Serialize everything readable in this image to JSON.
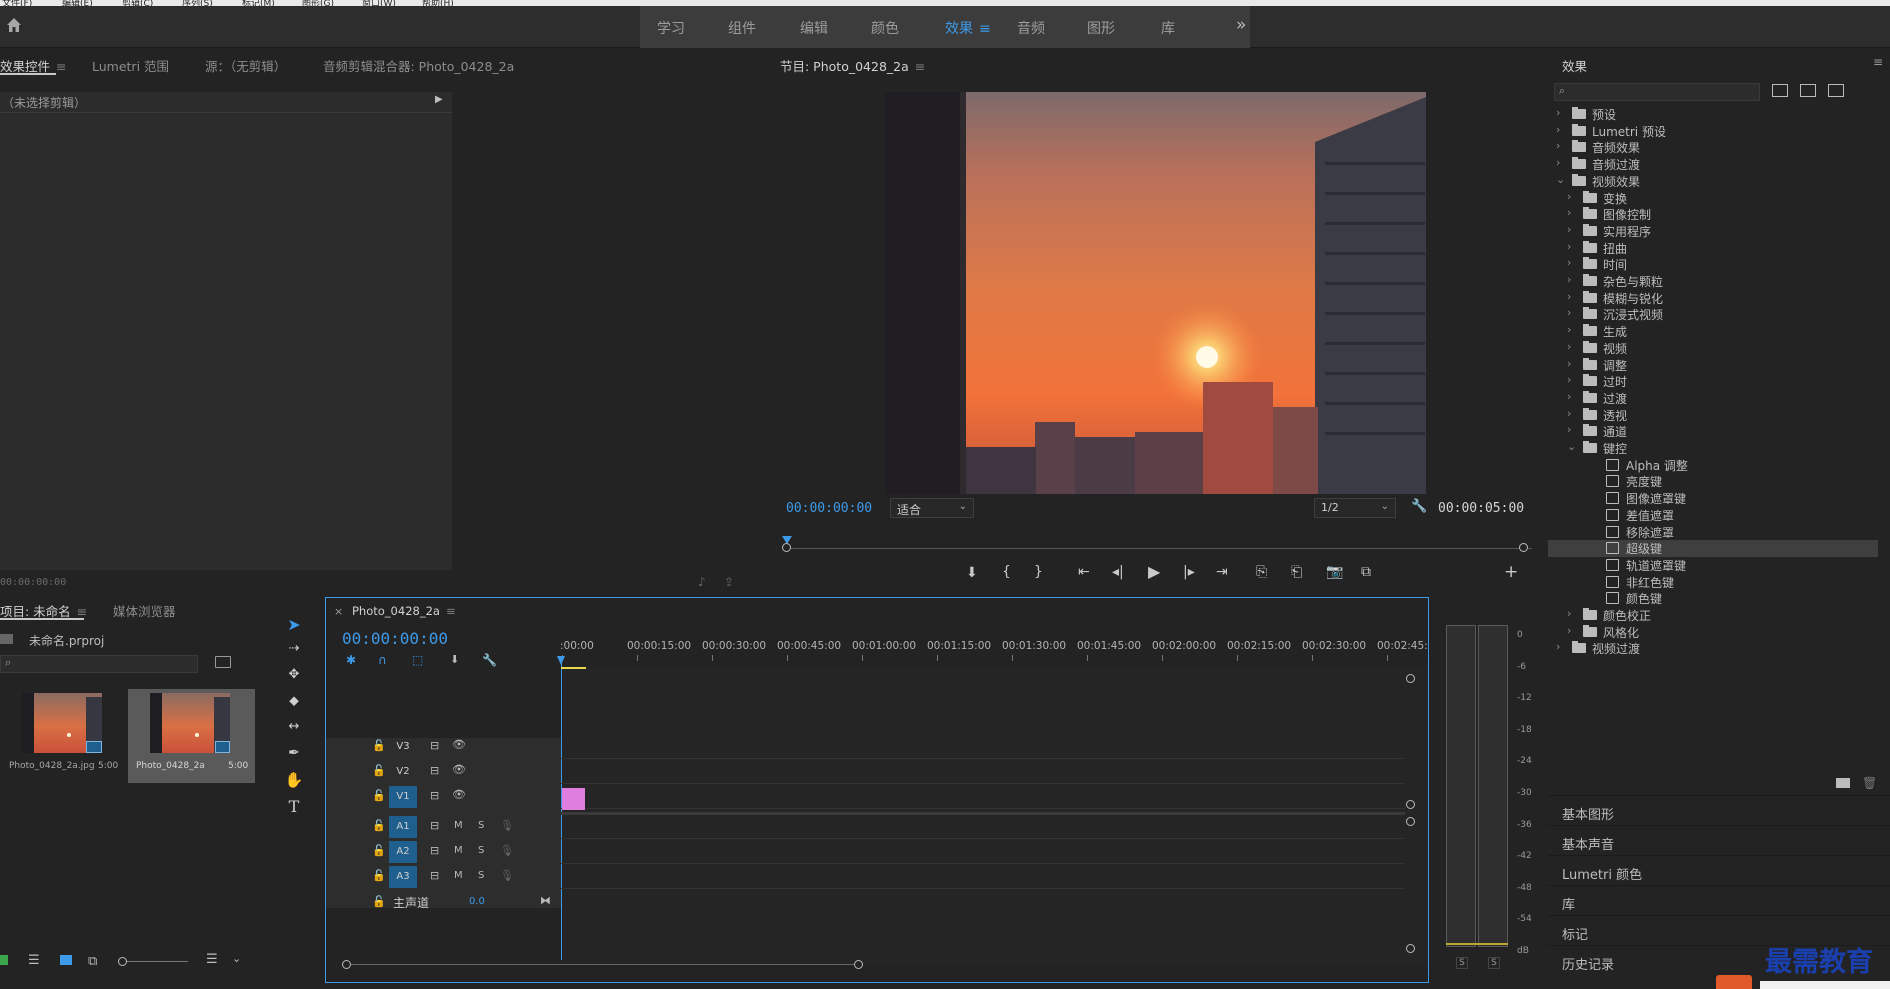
{
  "menubar": {
    "items": [
      "文件(F)",
      "编辑(E)",
      "剪辑(C)",
      "序列(S)",
      "标记(M)",
      "图形(G)",
      "窗口(W)",
      "帮助(H)"
    ]
  },
  "workspace": {
    "home_icon": "home-icon",
    "tabs": [
      {
        "label": "学习"
      },
      {
        "label": "组件"
      },
      {
        "label": "编辑"
      },
      {
        "label": "颜色"
      },
      {
        "label": "效果",
        "active": true
      },
      {
        "label": "音频"
      },
      {
        "label": "图形"
      },
      {
        "label": "库"
      }
    ],
    "overflow": "»"
  },
  "source_panel": {
    "tabs": [
      "效果控件",
      "Lumetri 范围",
      "源：（无剪辑）",
      "音频剪辑混合器: Photo_0428_2a"
    ],
    "no_clip": "（未选择剪辑）",
    "timecode": "00:00:00:00"
  },
  "program_monitor": {
    "title": "节目: Photo_0428_2a",
    "timecode_left": "00:00:00:00",
    "fit": "适合",
    "resolution": "1/2",
    "timecode_right": "00:00:05:00"
  },
  "project_panel": {
    "tabs": [
      "项目: 未命名",
      "媒体浏览器"
    ],
    "project_file": "未命名.prproj",
    "items": [
      {
        "name": "Photo_0428_2a.jpg",
        "duration": "5:00"
      },
      {
        "name": "Photo_0428_2a",
        "duration": "5:00"
      }
    ]
  },
  "timeline": {
    "sequence": "Photo_0428_2a",
    "timecode": "00:00:00:00",
    "ruler": [
      ":00:00",
      "00:00:15:00",
      "00:00:30:00",
      "00:00:45:00",
      "00:01:00:00",
      "00:01:15:00",
      "00:01:30:00",
      "00:01:45:00",
      "00:02:00:00",
      "00:02:15:00",
      "00:02:30:00",
      "00:02:45:"
    ],
    "video_tracks": [
      "V3",
      "V2",
      "V1"
    ],
    "audio_tracks": [
      "A1",
      "A2",
      "A3"
    ],
    "master_label": "主声道",
    "master_value": "0.0",
    "mute": "M",
    "solo": "S",
    "clip_color": "#e07ee0"
  },
  "audio_meter": {
    "scale": [
      "0",
      "-6",
      "-12",
      "-18",
      "-24",
      "-30",
      "-36",
      "-42",
      "-48",
      "-54",
      "dB"
    ],
    "solo_left": "S",
    "solo_right": "S"
  },
  "effects_panel": {
    "title": "效果",
    "tree": [
      {
        "label": "预设",
        "level": 0,
        "type": "folder",
        "expanded": false
      },
      {
        "label": "Lumetri 预设",
        "level": 0,
        "type": "folder",
        "expanded": false
      },
      {
        "label": "音频效果",
        "level": 0,
        "type": "folder",
        "expanded": false
      },
      {
        "label": "音频过渡",
        "level": 0,
        "type": "folder",
        "expanded": false
      },
      {
        "label": "视频效果",
        "level": 0,
        "type": "folder",
        "expanded": true
      },
      {
        "label": "变换",
        "level": 1,
        "type": "folder",
        "expanded": false
      },
      {
        "label": "图像控制",
        "level": 1,
        "type": "folder",
        "expanded": false
      },
      {
        "label": "实用程序",
        "level": 1,
        "type": "folder",
        "expanded": false
      },
      {
        "label": "扭曲",
        "level": 1,
        "type": "folder",
        "expanded": false
      },
      {
        "label": "时间",
        "level": 1,
        "type": "folder",
        "expanded": false
      },
      {
        "label": "杂色与颗粒",
        "level": 1,
        "type": "folder",
        "expanded": false
      },
      {
        "label": "模糊与锐化",
        "level": 1,
        "type": "folder",
        "expanded": false
      },
      {
        "label": "沉浸式视频",
        "level": 1,
        "type": "folder",
        "expanded": false
      },
      {
        "label": "生成",
        "level": 1,
        "type": "folder",
        "expanded": false
      },
      {
        "label": "视频",
        "level": 1,
        "type": "folder",
        "expanded": false
      },
      {
        "label": "调整",
        "level": 1,
        "type": "folder",
        "expanded": false
      },
      {
        "label": "过时",
        "level": 1,
        "type": "folder",
        "expanded": false
      },
      {
        "label": "过渡",
        "level": 1,
        "type": "folder",
        "expanded": false
      },
      {
        "label": "透视",
        "level": 1,
        "type": "folder",
        "expanded": false
      },
      {
        "label": "通道",
        "level": 1,
        "type": "folder",
        "expanded": false
      },
      {
        "label": "键控",
        "level": 1,
        "type": "folder",
        "expanded": true
      },
      {
        "label": "Alpha 调整",
        "level": 2,
        "type": "preset"
      },
      {
        "label": "亮度键",
        "level": 2,
        "type": "preset"
      },
      {
        "label": "图像遮罩键",
        "level": 2,
        "type": "preset"
      },
      {
        "label": "差值遮罩",
        "level": 2,
        "type": "preset"
      },
      {
        "label": "移除遮罩",
        "level": 2,
        "type": "preset"
      },
      {
        "label": "超级键",
        "level": 2,
        "type": "preset",
        "selected": true
      },
      {
        "label": "轨道遮罩键",
        "level": 2,
        "type": "preset"
      },
      {
        "label": "非红色键",
        "level": 2,
        "type": "preset"
      },
      {
        "label": "颜色键",
        "level": 2,
        "type": "preset"
      },
      {
        "label": "颜色校正",
        "level": 1,
        "type": "folder",
        "expanded": false
      },
      {
        "label": "风格化",
        "level": 1,
        "type": "folder",
        "expanded": false
      },
      {
        "label": "视频过渡",
        "level": 0,
        "type": "folder",
        "expanded": false
      }
    ],
    "sections": [
      "基本图形",
      "基本声音",
      "Lumetri 颜色",
      "库",
      "标记",
      "历史记录"
    ]
  },
  "watermark": {
    "text": "最需教育"
  },
  "colors": {
    "accent": "#3d9ae8",
    "panel_bg": "#232323",
    "clip": "#e07ee0"
  }
}
